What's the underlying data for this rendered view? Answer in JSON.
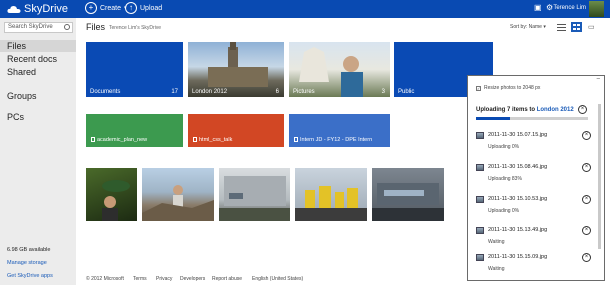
{
  "app": {
    "name": "SkyDrive",
    "create_label": "Create",
    "upload_label": "Upload",
    "user_name": "Terence Lim"
  },
  "sidebar": {
    "search_placeholder": "Search SkyDrive",
    "items": [
      {
        "label": "Files",
        "active": true
      },
      {
        "label": "Recent docs"
      },
      {
        "label": "Shared"
      },
      {
        "label": "Groups"
      },
      {
        "label": "PCs"
      }
    ],
    "storage": "6.98 GB available",
    "manage_storage": "Manage storage",
    "get_apps": "Get SkyDrive apps"
  },
  "main": {
    "title": "Files",
    "subtitle": "Terence Lim's SkyDrive",
    "sort_label": "Sort by: Name"
  },
  "folders": [
    {
      "name": "Documents",
      "count": "17",
      "color": "#0a4ab4"
    },
    {
      "name": "London 2012",
      "count": "6",
      "color": "#0a4ab4"
    },
    {
      "name": "Pictures",
      "count": "3",
      "color": "#0a4ab4"
    },
    {
      "name": "Public",
      "count": "",
      "color": "#0a4ab4"
    }
  ],
  "documents": [
    {
      "name": "academic_plan_new",
      "color": "#3c9a4f"
    },
    {
      "name": "html_css_talk",
      "color": "#d24724"
    },
    {
      "name": "Intern JD - FY12 - DPE Intern",
      "color": "#3b6fc8"
    }
  ],
  "footer": {
    "links": [
      "© 2012 Microsoft",
      "Terms",
      "Privacy",
      "Developers",
      "Report abuse",
      "English (United States)"
    ]
  },
  "upload_panel": {
    "resize_label": "Resize photos to 2048 px",
    "heading_prefix": "Uploading 7 items to",
    "heading_folder": "London 2012",
    "progress": 0.3,
    "items": [
      {
        "name": "2011-11-30 15.07.15.jpg",
        "status": "Uploading 0%"
      },
      {
        "name": "2011-11-30 15.08.46.jpg",
        "status": "Uploading 83%"
      },
      {
        "name": "2011-11-30 15.10.53.jpg",
        "status": "Uploading 0%"
      },
      {
        "name": "2011-11-30 15.13.49.jpg",
        "status": "Waiting"
      },
      {
        "name": "2011-11-30 15.15.09.jpg",
        "status": "Waiting"
      }
    ]
  },
  "colors": {
    "brand": "#094ab2",
    "sidebar_bg": "#ececec",
    "link": "#1a5bb8"
  }
}
